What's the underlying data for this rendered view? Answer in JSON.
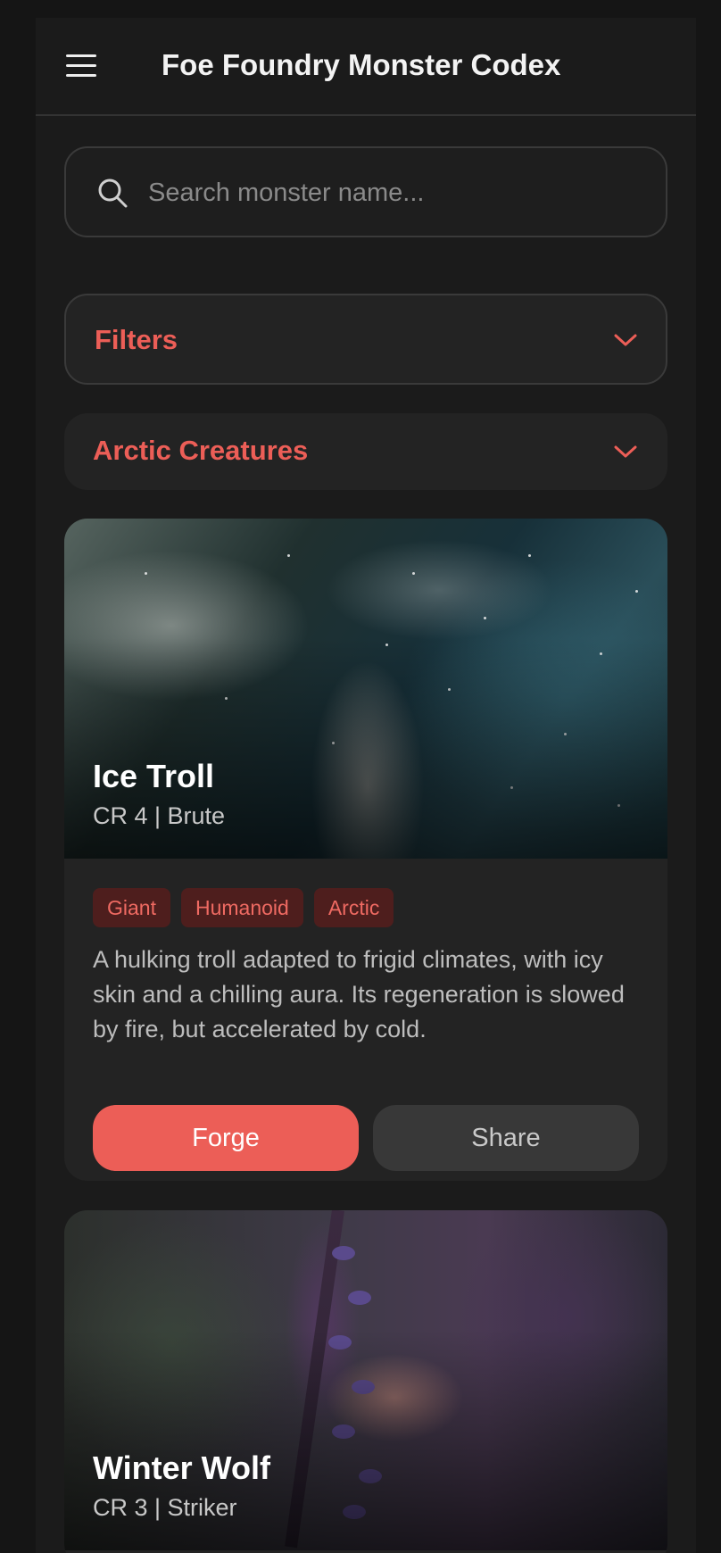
{
  "header": {
    "title": "Foe Foundry Monster Codex",
    "menu_icon": "hamburger-menu-icon"
  },
  "search": {
    "placeholder": "Search monster name...",
    "value": "",
    "icon": "search-icon"
  },
  "filters": {
    "label": "Filters",
    "icon": "chevron-down-icon"
  },
  "group": {
    "label": "Arctic Creatures",
    "icon": "chevron-down-icon"
  },
  "monsters": [
    {
      "name": "Ice Troll",
      "meta": "CR 4 | Brute",
      "tags": [
        "Giant",
        "Humanoid",
        "Arctic"
      ],
      "description": "A hulking troll adapted to frigid climates, with icy skin and a chilling aura. Its regeneration is slowed by fire, but accelerated by cold.",
      "forge_label": "Forge",
      "share_label": "Share"
    },
    {
      "name": "Winter Wolf",
      "meta": "CR 3 | Striker"
    }
  ],
  "colors": {
    "accent": "#ec5e57",
    "background": "#151515",
    "surface": "#232323",
    "tag_background": "#4e1e1d"
  }
}
